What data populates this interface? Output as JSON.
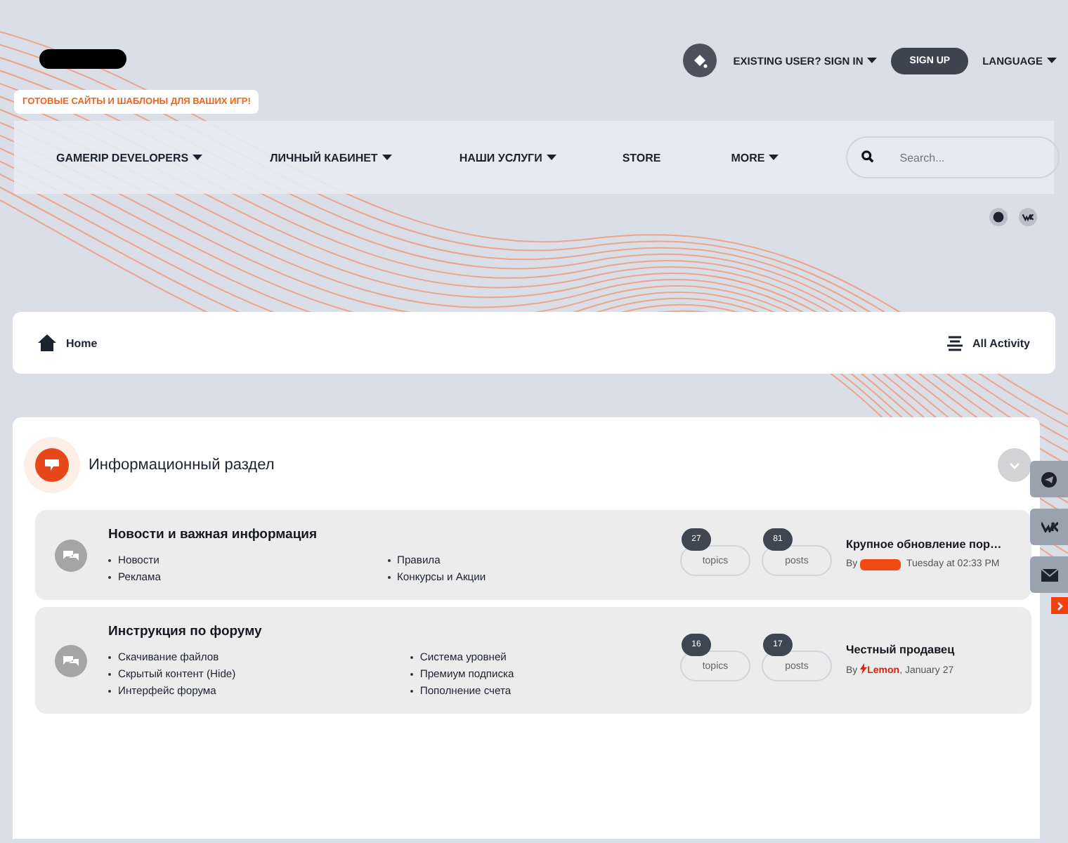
{
  "header": {
    "tagline": "ГОТОВЫЕ САЙТЫ И ШАБЛОНЫ ДЛЯ ВАШИХ ИГР!",
    "sign_in": {
      "label": "EXISTING USER? SIGN IN",
      "has_dropdown": true
    },
    "sign_up": "SIGN UP",
    "language": {
      "label": "LANGUAGE",
      "has_dropdown": true
    }
  },
  "nav": {
    "items": [
      {
        "label": "GAMERIP DEVELOPERS",
        "has_dropdown": true
      },
      {
        "label": "ЛИЧНЫЙ КАБИНЕТ",
        "has_dropdown": true
      },
      {
        "label": "НАШИ УСЛУГИ",
        "has_dropdown": true
      },
      {
        "label": "STORE",
        "has_dropdown": false
      },
      {
        "label": "MORE",
        "has_dropdown": true
      }
    ],
    "search": {
      "placeholder": "Search..."
    }
  },
  "breadcrumb": {
    "home": "Home",
    "activity": "All Activity"
  },
  "category": {
    "title": "Информационный раздел",
    "forums": [
      {
        "title": "Новости и важная информация",
        "subforums": [
          "Новости",
          "Реклама",
          "Правила",
          "Конкурсы и Акции"
        ],
        "topics": "27",
        "topics_label": "topics",
        "posts": "81",
        "posts_label": "posts",
        "last_post": {
          "title": "Крупное обновление пор…",
          "by": "By",
          "author_hidden": true,
          "date": "Tuesday at 02:33 PM"
        }
      },
      {
        "title": "Инструкция по форуму",
        "subforums": [
          "Скачивание файлов",
          "Скрытый контент (Hide)",
          "Интерфейс форума",
          "Система уровней",
          "Премиум подписка",
          "Пополнение счета"
        ],
        "topics": "16",
        "topics_label": "topics",
        "posts": "17",
        "posts_label": "posts",
        "last_post": {
          "title": "Честный продавец",
          "by": "By",
          "author_hidden": false,
          "author": "Lemon",
          "date": ", January 27"
        }
      }
    ]
  }
}
